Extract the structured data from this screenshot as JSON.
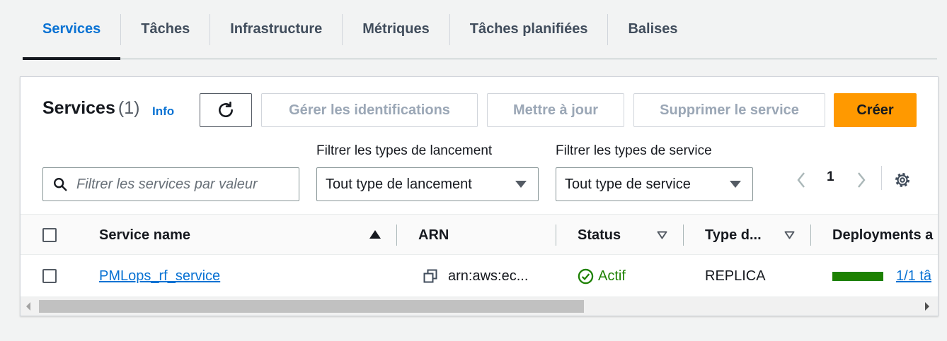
{
  "tabs": [
    {
      "label": "Services",
      "active": true
    },
    {
      "label": "Tâches"
    },
    {
      "label": "Infrastructure"
    },
    {
      "label": "Métriques"
    },
    {
      "label": "Tâches planifiées"
    },
    {
      "label": "Balises"
    }
  ],
  "header": {
    "title": "Services",
    "count": "(1)",
    "info": "Info"
  },
  "buttons": {
    "refresh_icon": "refresh-icon",
    "manage_tags": "Gérer les identifications",
    "update": "Mettre à jour",
    "delete": "Supprimer le service",
    "create": "Créer"
  },
  "filters": {
    "search_placeholder": "Filtrer les services par valeur",
    "launch_label": "Filtrer les types de lancement",
    "launch_value": "Tout type de lancement",
    "service_label": "Filtrer les types de service",
    "service_value": "Tout type de service"
  },
  "pagination": {
    "page": "1"
  },
  "table": {
    "columns": [
      "Service name",
      "ARN",
      "Status",
      "Type d...",
      "Deployments a"
    ],
    "rows": [
      {
        "service_name": "PMLops_rf_service",
        "arn": "arn:aws:ec...",
        "status": "Actif",
        "type": "REPLICA",
        "deployments": "1/1 tâ",
        "deployment_progress": 1.0
      }
    ]
  },
  "colors": {
    "accent": "#0972d3",
    "primary": "#ff9900",
    "success": "#1d8102"
  }
}
